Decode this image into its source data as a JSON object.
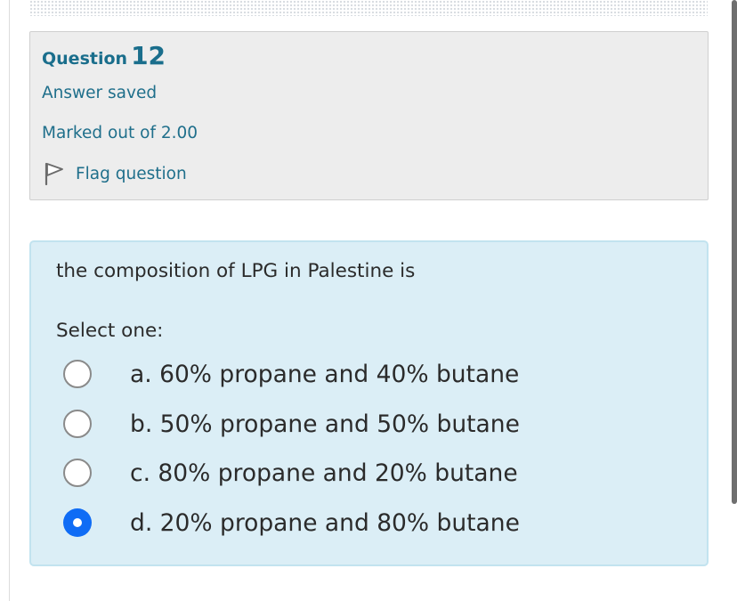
{
  "question": {
    "word": "Question",
    "number": "12",
    "status": "Answer saved",
    "marks": "Marked out of 2.00",
    "flag_label": "Flag question",
    "flag_icon": "flag-icon"
  },
  "content": {
    "question_text": "the composition of LPG in Palestine is",
    "select_prompt": "Select one:",
    "options": [
      {
        "label": "a. 60% propane and 40% butane",
        "selected": false
      },
      {
        "label": "b. 50% propane and 50% butane",
        "selected": false
      },
      {
        "label": "c. 80% propane and 20% butane",
        "selected": false
      },
      {
        "label": "d. 20% propane and 80% butane",
        "selected": true
      }
    ]
  },
  "colors": {
    "link_teal": "#1f6f8b",
    "info_background": "#ededed",
    "content_background": "#dbeef6",
    "content_border": "#c2e3ef",
    "radio_selected": "#0f6cf5"
  }
}
